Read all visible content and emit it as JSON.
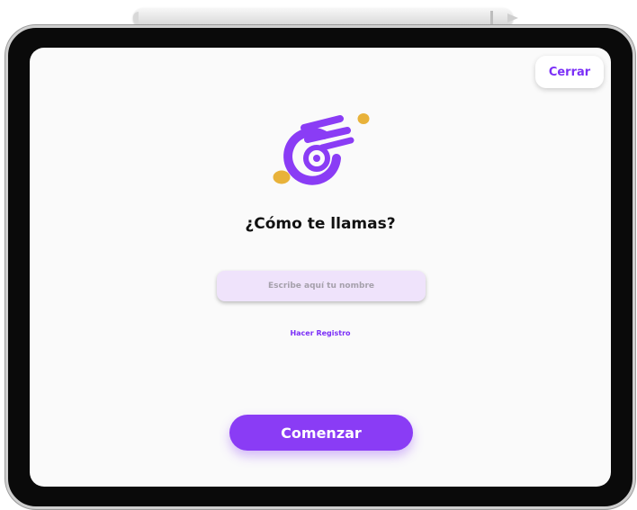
{
  "header": {
    "close_label": "Cerrar"
  },
  "main": {
    "logo_icon": "spinning-wheel-logo-icon",
    "title": "¿Cómo te llamas?",
    "name_input": {
      "value": "",
      "placeholder": "Escribe aquí tu nombre"
    },
    "register_link": "Hacer Registro",
    "start_label": "Comenzar"
  },
  "colors": {
    "accent": "#8a3cf5",
    "accent_text": "#7b2ff7",
    "logo_dot": "#e8b23a",
    "input_bg": "#efe3fb",
    "screen_bg": "#fafafa"
  }
}
